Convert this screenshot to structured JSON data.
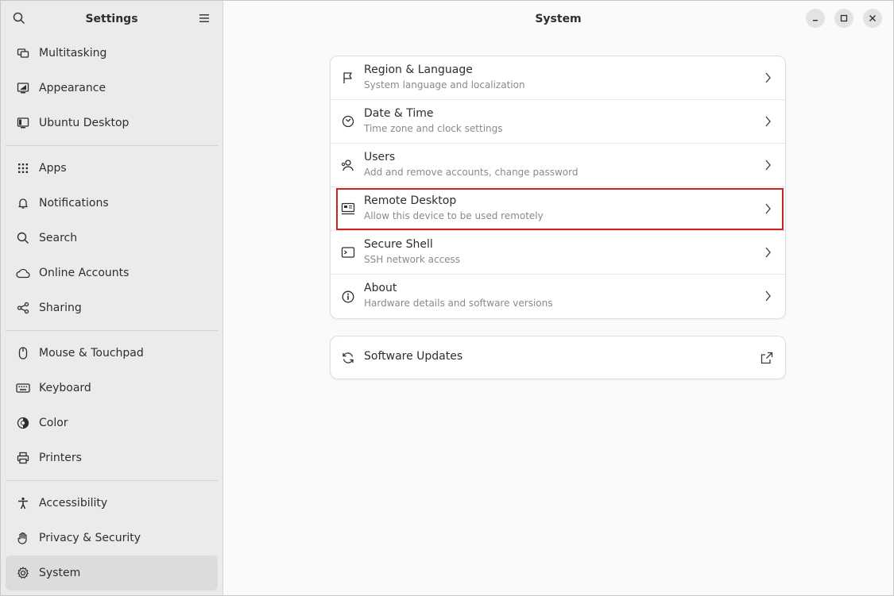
{
  "sidebar": {
    "title": "Settings",
    "items": [
      {
        "label": "Multitasking",
        "icon": "multitasking-icon"
      },
      {
        "label": "Appearance",
        "icon": "appearance-icon"
      },
      {
        "label": "Ubuntu Desktop",
        "icon": "ubuntu-desktop-icon"
      },
      {
        "label": "Apps",
        "icon": "apps-grid-icon"
      },
      {
        "label": "Notifications",
        "icon": "bell-icon"
      },
      {
        "label": "Search",
        "icon": "search-icon"
      },
      {
        "label": "Online Accounts",
        "icon": "cloud-icon"
      },
      {
        "label": "Sharing",
        "icon": "share-icon"
      },
      {
        "label": "Mouse & Touchpad",
        "icon": "mouse-icon"
      },
      {
        "label": "Keyboard",
        "icon": "keyboard-icon"
      },
      {
        "label": "Color",
        "icon": "color-icon"
      },
      {
        "label": "Printers",
        "icon": "printer-icon"
      },
      {
        "label": "Accessibility",
        "icon": "accessibility-icon"
      },
      {
        "label": "Privacy & Security",
        "icon": "hand-icon"
      },
      {
        "label": "System",
        "icon": "gear-icon",
        "selected": true
      }
    ]
  },
  "content": {
    "title": "System",
    "rows": [
      {
        "title": "Region & Language",
        "subtitle": "System language and localization",
        "icon": "flag-icon"
      },
      {
        "title": "Date & Time",
        "subtitle": "Time zone and clock settings",
        "icon": "clock-icon"
      },
      {
        "title": "Users",
        "subtitle": "Add and remove accounts, change password",
        "icon": "users-icon"
      },
      {
        "title": "Remote Desktop",
        "subtitle": "Allow this device to be used remotely",
        "icon": "remote-desktop-icon",
        "highlighted": true
      },
      {
        "title": "Secure Shell",
        "subtitle": "SSH network access",
        "icon": "terminal-icon"
      },
      {
        "title": "About",
        "subtitle": "Hardware details and software versions",
        "icon": "info-icon"
      }
    ],
    "updates": {
      "title": "Software Updates",
      "icon": "refresh-icon",
      "action_icon": "external-link-icon"
    }
  },
  "colors": {
    "highlight": "#cc2222",
    "sidebar_bg": "#ebebeb",
    "selected_bg": "#dcdcdc"
  }
}
